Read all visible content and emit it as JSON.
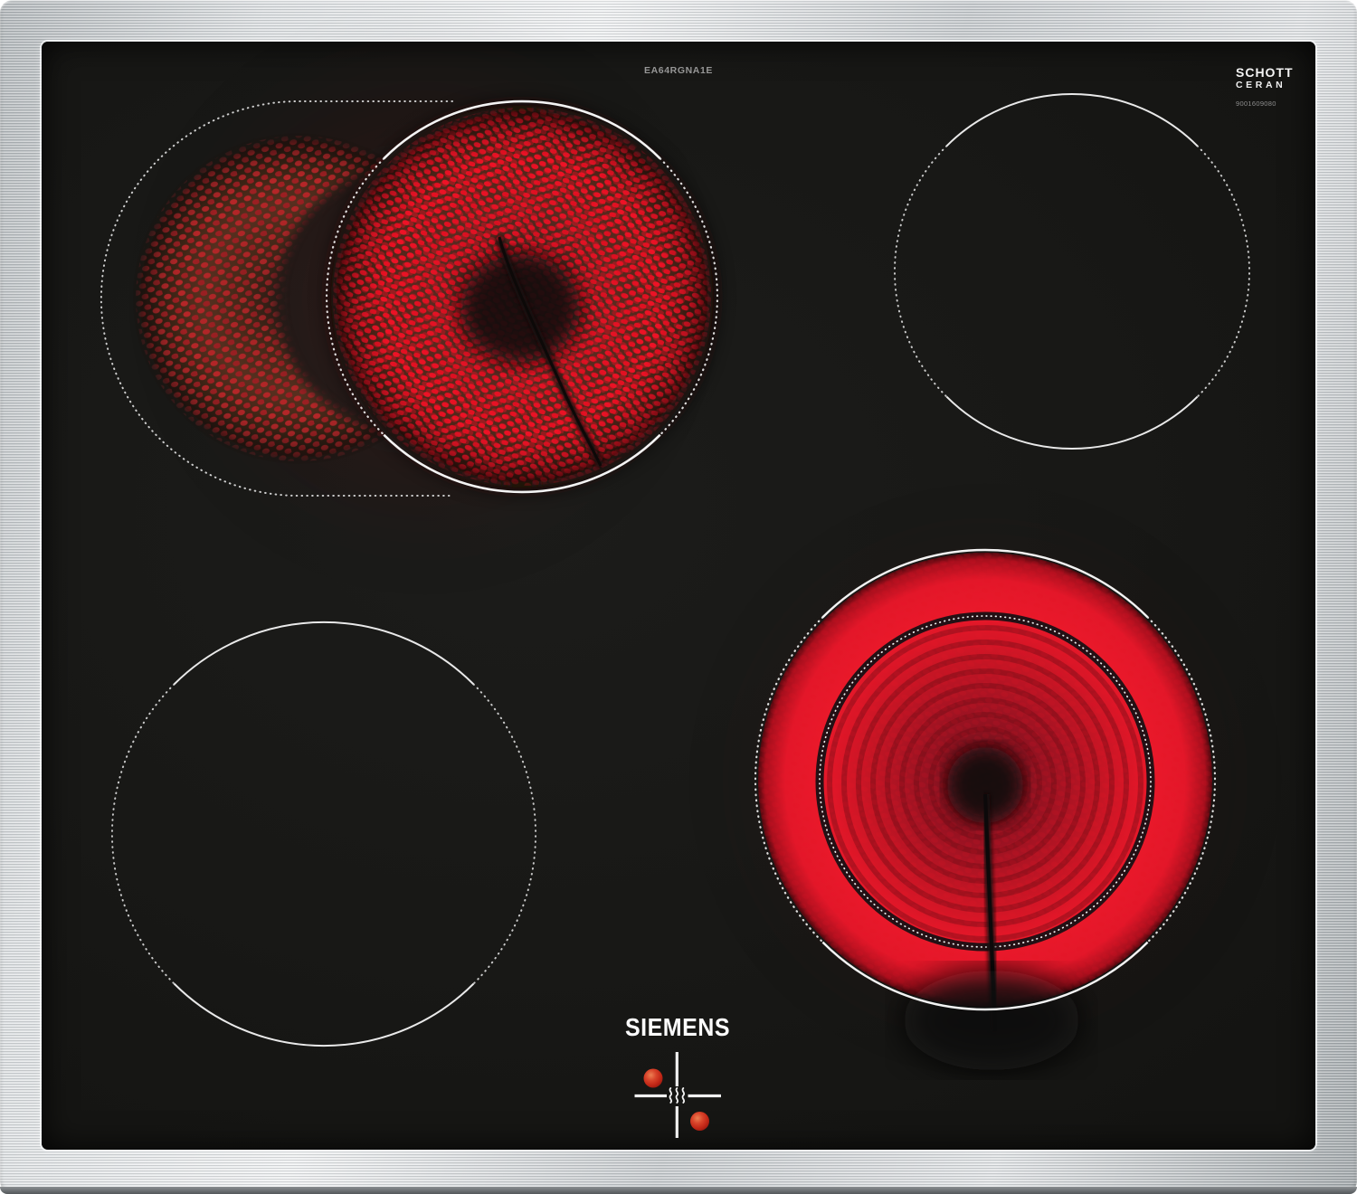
{
  "labels": {
    "model_number": "EA64RGNA1E",
    "glass_brand_line1": "SCHOTT",
    "glass_brand_line2": "CERAN",
    "glass_code": "9001609080",
    "brand": "SIEMENS"
  },
  "zones": [
    {
      "id": "rear-left",
      "type": "dual-extension-roasting-zone",
      "status": "heating",
      "glow": "bright red coil with dim crescent extension"
    },
    {
      "id": "rear-right",
      "type": "single-zone",
      "status": "off"
    },
    {
      "id": "front-left",
      "type": "single-zone",
      "status": "off"
    },
    {
      "id": "front-right",
      "type": "dual-circuit-zone",
      "status": "heating",
      "glow": "full bright red glow"
    }
  ],
  "indicators": {
    "residual_heat_icon": "steam-waves",
    "led_count": 2,
    "led_color": "#cf3a1e"
  },
  "colors": {
    "glass": "#191917",
    "steel": "#c9cdd0",
    "heat_red_bright": "#e8121f",
    "heat_red_dim": "#b02428",
    "zone_marking": "#f2f2f2"
  }
}
